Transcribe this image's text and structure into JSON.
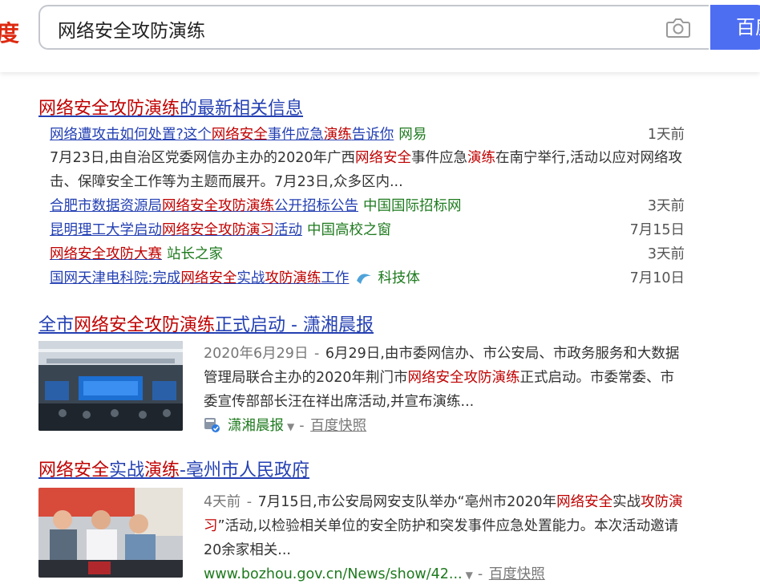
{
  "header": {
    "logo_fragment": "度",
    "search_query": "网络安全攻防演练",
    "search_button": "百度一下"
  },
  "news_block": {
    "title_hl": "网络安全攻防演练",
    "title_rest": "的最新相关信息",
    "items": [
      {
        "t1": "网络遭攻击如何处置?这个",
        "t2": "网络安全",
        "t3": "事件应急",
        "t4": "演练",
        "t5": "告诉你",
        "source": "网易",
        "date": "1天前"
      },
      {
        "t1": "合肥市数据资源局",
        "t2": "网络安全攻防演练",
        "t3": "公开招标公告",
        "source": "中国国际招标网",
        "date": "3天前"
      },
      {
        "t1": "昆明理工大学启动",
        "t2": "网络安全攻防演习",
        "t3": "活动",
        "source": "中国高校之窗",
        "date": "7月15日"
      },
      {
        "t1": "网络安全攻防大赛",
        "source": "站长之家",
        "date": "3天前"
      },
      {
        "t1": "国网天津电科院:完成",
        "t2": "网络安全",
        "t3": "实战",
        "t4": "攻防演练",
        "t5": "工作",
        "source": "科技体",
        "date": "7月10日"
      }
    ],
    "snippet": {
      "s1": "7月23日,由自治区党委网信办主办的2020年广西",
      "s2": "网络安全",
      "s3": "事件应急",
      "s4": "演练",
      "s5": "在南宁举行,活动以应对网络攻击、保障安全工作等为主题而展开。7月23日,众多区内..."
    }
  },
  "result2": {
    "title1": "全市",
    "title2": "网络安全攻防演练",
    "title3": "正式启动 - 潇湘晨报",
    "date": "2020年6月29日",
    "a1": "6月29日,由市委网信办、市公安局、市政务服务和大数据管理局联合主办的2020年荆门市",
    "a2": "网络安全攻防演练",
    "a3": "正式启动。市委常委、市委宣传部部长汪在祥出席活动,并宣布演练...",
    "source": "潇湘晨报",
    "snapshot": "百度快照"
  },
  "result3": {
    "title1": "网络安全",
    "title2": "实战",
    "title3": "演练",
    "title4": "-亳州市人民政府",
    "date": "4天前",
    "a1": "7月15日,市公安局网安支队举办“亳州市2020年",
    "a2": "网络安全",
    "a3": "实战",
    "a4": "攻防演习",
    "a5": "”活动,以检验相关单位的安全防护和突发事件应急处置能力。本次活动邀请20余家相关...",
    "url": "www.bozhou.gov.cn/News/show/42...",
    "snapshot": "百度快照"
  },
  "colors": {
    "link": "#2440b3",
    "highlight": "#c00000",
    "source_green": "#1e7a1e",
    "brand_blue": "#4e6ef2"
  },
  "icons": [
    "camera-icon",
    "wave-icon",
    "source-badge-icon",
    "caret-down-icon"
  ]
}
